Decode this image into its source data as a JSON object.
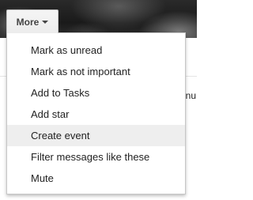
{
  "toolbar": {
    "more_label": "More",
    "more_icon": "chevron-down-icon"
  },
  "more_menu": {
    "items": [
      {
        "label": "Mark as unread"
      },
      {
        "label": "Mark as not important"
      },
      {
        "label": "Add to Tasks"
      },
      {
        "label": "Add star"
      },
      {
        "label": "Create event",
        "highlighted": true
      },
      {
        "label": "Filter messages like these"
      },
      {
        "label": "Mute"
      }
    ]
  },
  "background": {
    "peek_text": "inu"
  },
  "colors": {
    "menu_border": "#c6c6c6",
    "highlight": "#eeeeee",
    "text": "#222222",
    "button_text": "#444444"
  }
}
